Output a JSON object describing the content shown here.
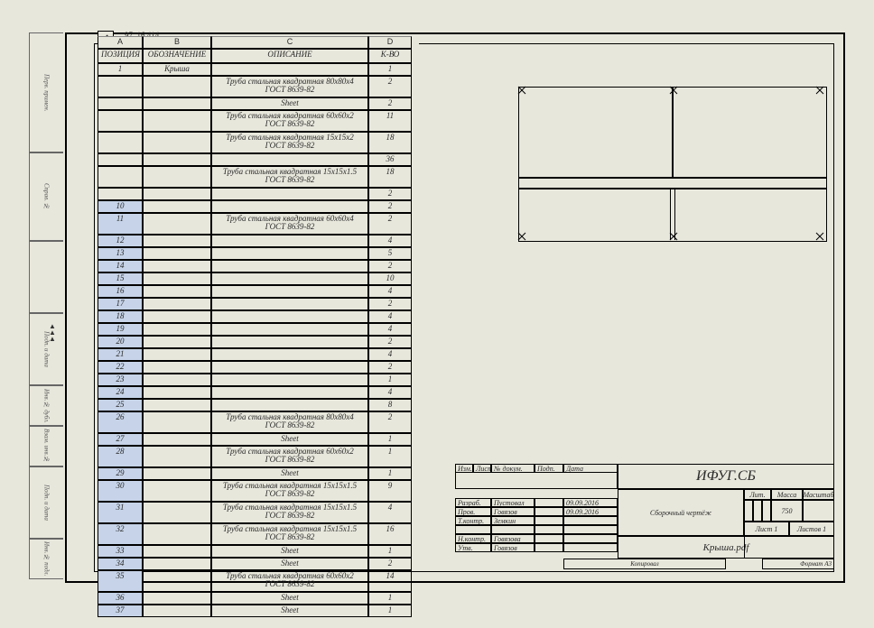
{
  "top_coord": "97, 16.414",
  "columns": {
    "A": "A",
    "B": "B",
    "C": "C",
    "D": "D"
  },
  "headers": {
    "A": "ПОЗИЦИЯ",
    "B": "ОБОЗНАЧЕНИЕ",
    "C": "ОПИСАНИЕ",
    "D": "К-ВО"
  },
  "rows": [
    {
      "n": "2",
      "A": "1",
      "B": "Крыша",
      "C": "",
      "D": "1",
      "tall": false
    },
    {
      "n": "3",
      "A": "",
      "B": "",
      "C": "Труба стальная квадратная 80x80x4\nГОСТ 8639-82",
      "D": "2",
      "tall": true
    },
    {
      "n": "4",
      "A": "",
      "B": "",
      "C": "Sheet",
      "D": "2",
      "tall": false
    },
    {
      "n": "5",
      "A": "",
      "B": "",
      "C": "Труба стальная квадратная 60x60x2\nГОСТ 8639-82",
      "D": "11",
      "tall": true
    },
    {
      "n": "6",
      "A": "",
      "B": "",
      "C": "Труба стальная квадратная 15x15x2\nГОСТ 8639-82",
      "D": "18",
      "tall": true
    },
    {
      "n": "7",
      "A": "",
      "B": "",
      "C": "",
      "D": "36",
      "tall": false
    },
    {
      "n": "8",
      "A": "",
      "B": "",
      "C": "Труба стальная квадратная 15x15x1.5\nГОСТ 8639-82",
      "D": "18",
      "tall": true
    },
    {
      "n": "9",
      "A": "",
      "B": "",
      "C": "",
      "D": "2",
      "tall": false
    },
    {
      "n": "10",
      "A": "10",
      "B": "",
      "C": "",
      "D": "2",
      "tall": false
    },
    {
      "n": "11",
      "A": "11",
      "B": "",
      "C": "Труба стальная квадратная 60x60x4\nГОСТ 8639-82",
      "D": "2",
      "tall": true
    },
    {
      "n": "12",
      "A": "12",
      "B": "",
      "C": "",
      "D": "4",
      "tall": false
    },
    {
      "n": "13",
      "A": "13",
      "B": "",
      "C": "",
      "D": "5",
      "tall": false
    },
    {
      "n": "14",
      "A": "14",
      "B": "",
      "C": "",
      "D": "2",
      "tall": false
    },
    {
      "n": "15",
      "A": "15",
      "B": "",
      "C": "",
      "D": "10",
      "tall": false
    },
    {
      "n": "16",
      "A": "16",
      "B": "",
      "C": "",
      "D": "4",
      "tall": false
    },
    {
      "n": "17",
      "A": "17",
      "B": "",
      "C": "",
      "D": "2",
      "tall": false
    },
    {
      "n": "18",
      "A": "18",
      "B": "",
      "C": "",
      "D": "4",
      "tall": false
    },
    {
      "n": "19",
      "A": "19",
      "B": "",
      "C": "",
      "D": "4",
      "tall": false
    },
    {
      "n": "20",
      "A": "20",
      "B": "",
      "C": "",
      "D": "2",
      "tall": false
    },
    {
      "n": "21",
      "A": "21",
      "B": "",
      "C": "",
      "D": "4",
      "tall": false
    },
    {
      "n": "22",
      "A": "22",
      "B": "",
      "C": "",
      "D": "2",
      "tall": false
    },
    {
      "n": "23",
      "A": "23",
      "B": "",
      "C": "",
      "D": "1",
      "tall": false
    },
    {
      "n": "24",
      "A": "24",
      "B": "",
      "C": "",
      "D": "4",
      "tall": false
    },
    {
      "n": "25",
      "A": "25",
      "B": "",
      "C": "",
      "D": "8",
      "tall": false
    },
    {
      "n": "26",
      "A": "26",
      "B": "",
      "C": "Труба стальная квадратная 80x80x4\nГОСТ 8639-82",
      "D": "2",
      "tall": true
    },
    {
      "n": "27",
      "A": "27",
      "B": "",
      "C": "Sheet",
      "D": "1",
      "tall": false
    },
    {
      "n": "28",
      "A": "28",
      "B": "",
      "C": "Труба стальная квадратная 60x60x2\nГОСТ 8639-82",
      "D": "1",
      "tall": true
    },
    {
      "n": "29",
      "A": "29",
      "B": "",
      "C": "Sheet",
      "D": "1",
      "tall": false
    },
    {
      "n": "30",
      "A": "30",
      "B": "",
      "C": "Труба стальная квадратная 15x15x1.5\nГОСТ 8639-82",
      "D": "9",
      "tall": true
    },
    {
      "n": "31",
      "A": "31",
      "B": "",
      "C": "Труба стальная квадратная 15x15x1.5\nГОСТ 8639-82",
      "D": "4",
      "tall": true
    },
    {
      "n": "32",
      "A": "32",
      "B": "",
      "C": "Труба стальная квадратная 15x15x1.5\nГОСТ 8639-82",
      "D": "16",
      "tall": true
    },
    {
      "n": "33",
      "A": "33",
      "B": "",
      "C": "Sheet",
      "D": "1",
      "tall": false
    },
    {
      "n": "34",
      "A": "34",
      "B": "",
      "C": "Sheet",
      "D": "2",
      "tall": false
    },
    {
      "n": "35",
      "A": "35",
      "B": "",
      "C": "Труба стальная квадратная 60x60x2\nГОСТ 8639-82",
      "D": "14",
      "tall": true
    },
    {
      "n": "36",
      "A": "36",
      "B": "",
      "C": "Sheet",
      "D": "1",
      "tall": false
    },
    {
      "n": "37",
      "A": "37",
      "B": "",
      "C": "Sheet",
      "D": "1",
      "tall": false
    }
  ],
  "title_block": {
    "code": "ИФУГ.СБ",
    "drawing_type": "Сборочный чертёж",
    "filename": "Крыша.pdf",
    "format": "Формат A3",
    "mass": "750",
    "scale": "",
    "hdr": {
      "izm": "Изм.",
      "list": "Лист",
      "ndok": "№ докум.",
      "podp": "Подп.",
      "data": "Дата",
      "lit": "Лит.",
      "massa": "Масса",
      "masht": "Масштаб",
      "list2": "Лист 1",
      "listov": "Листов 1"
    },
    "roles": [
      {
        "role": "Разраб.",
        "name": "Пустовал",
        "date": "09.09.2016"
      },
      {
        "role": "Пров.",
        "name": "Говязов",
        "date": "09.09.2016"
      },
      {
        "role": "Т.контр.",
        "name": "Земкин",
        "date": ""
      },
      {
        "role": "Н.контр.",
        "name": "Говязова",
        "date": ""
      },
      {
        "role": "Утв.",
        "name": "Говязов",
        "date": ""
      }
    ],
    "copied": "Копировал"
  },
  "left_fields": [
    "Перв. примен.",
    "Справ. №",
    "",
    "Подп. и дата",
    "Инв.№ дубл.",
    "Взам. инв.№",
    "Подп. и дата",
    "Инв.№ подл."
  ]
}
